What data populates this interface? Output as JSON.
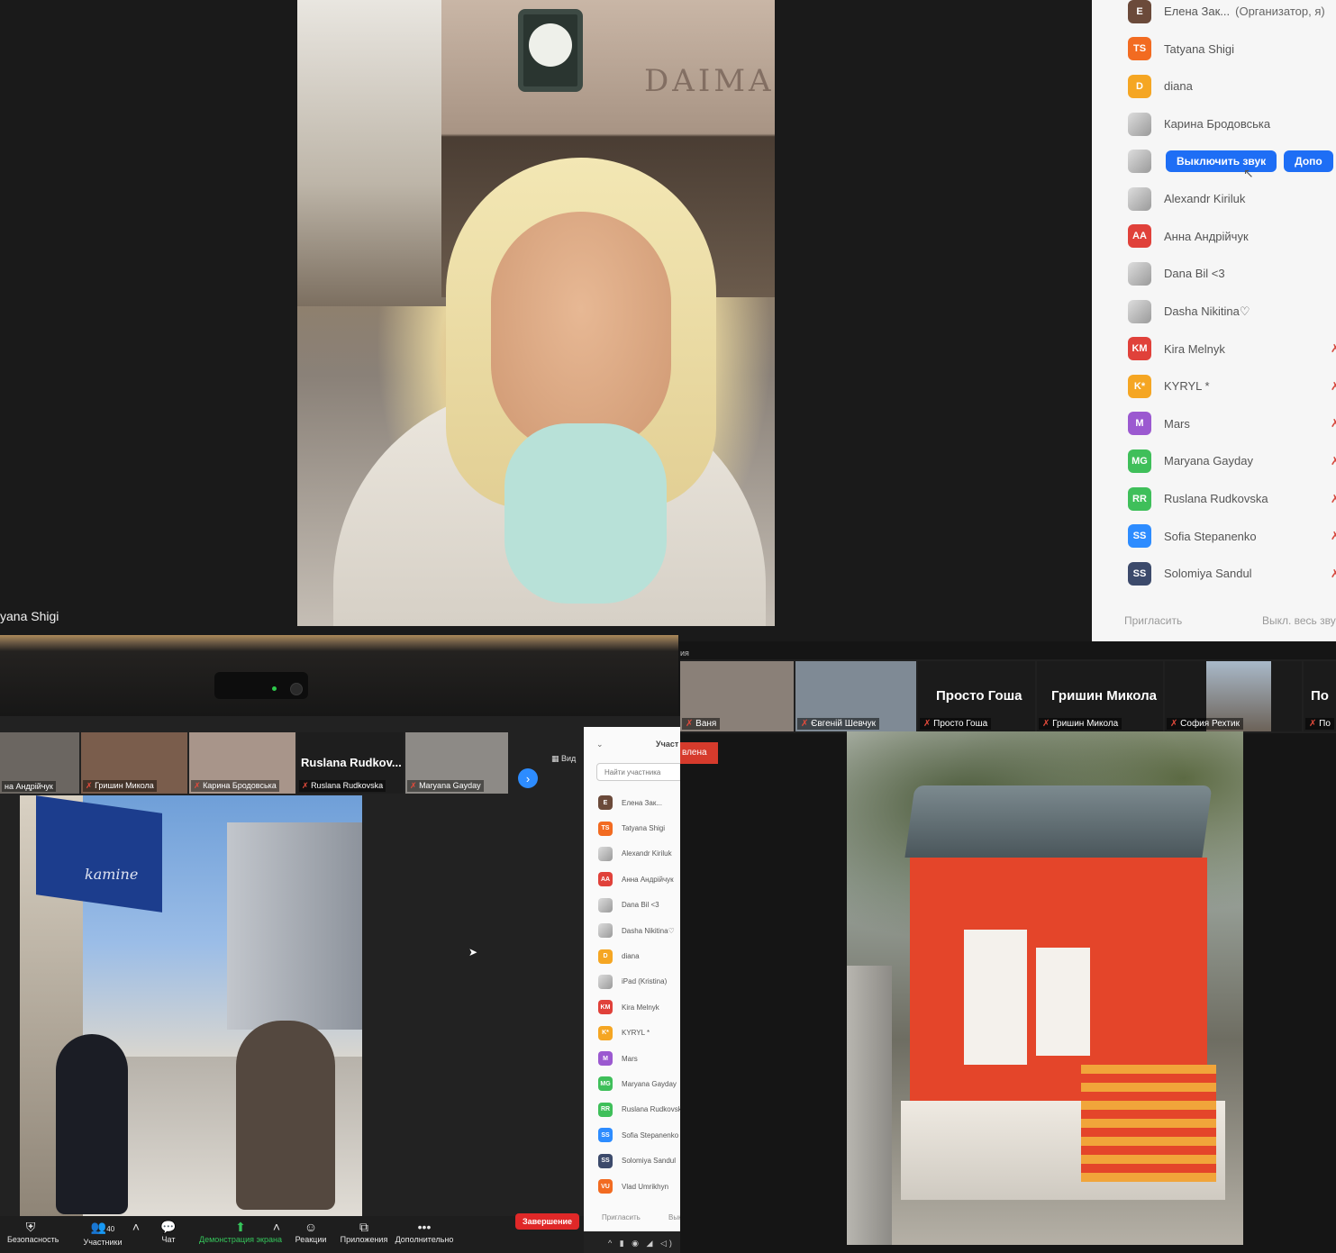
{
  "top": {
    "speaker_label": "yana Shigi",
    "video_sign": "DAIMARU",
    "participants": [
      {
        "initials": "E",
        "name": "Елена Зак...",
        "meta": "(Организатор, я)",
        "color": "#6b4a3a"
      },
      {
        "initials": "TS",
        "name": "Tatyana Shigi",
        "color": "#f26b21"
      },
      {
        "initials": "D",
        "name": "diana",
        "color": "#f5a623"
      },
      {
        "initials": "",
        "name": "Карина Бродовська",
        "img": true
      },
      {
        "initials": "",
        "name": "",
        "img": true,
        "buttons": true
      },
      {
        "initials": "",
        "name": "Alexandr Kiriluk",
        "img": true
      },
      {
        "initials": "AA",
        "name": "Анна Андрійчук",
        "color": "#e0413a"
      },
      {
        "initials": "",
        "name": "Dana Bil <3",
        "img": true
      },
      {
        "initials": "",
        "name": "Dasha Nikitina♡",
        "img": true
      },
      {
        "initials": "KM",
        "name": "Kira Melnyk",
        "color": "#e0413a"
      },
      {
        "initials": "K*",
        "name": "KYRYL *",
        "color": "#f5a623"
      },
      {
        "initials": "M",
        "name": "Mars",
        "color": "#9b59d0"
      },
      {
        "initials": "MG",
        "name": "Maryana Gayday",
        "color": "#3fbf5a"
      },
      {
        "initials": "RR",
        "name": "Ruslana Rudkovska",
        "color": "#3fbf5a"
      },
      {
        "initials": "SS",
        "name": "Sofia Stepanenko",
        "color": "#2d8cff"
      },
      {
        "initials": "SS",
        "name": "Solomiya Sandul",
        "color": "#3c4a6b"
      }
    ],
    "mute_button": "Выключить звук",
    "more_button": "Допо",
    "invite": "Пригласить",
    "mute_all": "Выкл. весь звук"
  },
  "bottom_left": {
    "thumbs": [
      {
        "label": "на Андрійчук"
      },
      {
        "label": "Гришин Микола"
      },
      {
        "label": "Карина Бродовська"
      },
      {
        "label": "Ruslana Rudkovska",
        "big": "Ruslana  Rudkov..."
      },
      {
        "label": "Maryana Gayday"
      }
    ],
    "next": "›",
    "view": "Вид",
    "panel_title": "Участ",
    "search_placeholder": "Найти участника",
    "video_sign": "kamine",
    "participants": [
      {
        "initials": "E",
        "name": "Елена Зак...",
        "color": "#6b4a3a"
      },
      {
        "initials": "TS",
        "name": "Tatyana Shigi",
        "color": "#f26b21"
      },
      {
        "initials": "",
        "name": "Alexandr Kiriluk",
        "img": true
      },
      {
        "initials": "AA",
        "name": "Анна Андрійчук",
        "color": "#e0413a"
      },
      {
        "initials": "",
        "name": "Dana Bil <3",
        "img": true
      },
      {
        "initials": "",
        "name": "Dasha Nikitina♡",
        "img": true
      },
      {
        "initials": "D",
        "name": "diana",
        "color": "#f5a623"
      },
      {
        "initials": "",
        "name": "iPad (Kristina)",
        "img": true
      },
      {
        "initials": "KM",
        "name": "Kira Melnyk",
        "color": "#e0413a"
      },
      {
        "initials": "K*",
        "name": "KYRYL *",
        "color": "#f5a623"
      },
      {
        "initials": "M",
        "name": "Mars",
        "color": "#9b59d0"
      },
      {
        "initials": "MG",
        "name": "Maryana Gayday",
        "color": "#3fbf5a"
      },
      {
        "initials": "RR",
        "name": "Ruslana Rudkovsk",
        "color": "#3fbf5a"
      },
      {
        "initials": "SS",
        "name": "Sofia Stepanenko",
        "color": "#2d8cff"
      },
      {
        "initials": "SS",
        "name": "Solomiya Sandul",
        "color": "#3c4a6b"
      },
      {
        "initials": "VU",
        "name": "Vlad Umrikhyn",
        "color": "#f26b21"
      }
    ],
    "invite": "Пригласить",
    "invite2": "Вык",
    "toolbar": {
      "security": "Безопасность",
      "participants": "Участники",
      "participants_count": "40",
      "chat": "Чат",
      "share": "Демонстрация экрана",
      "reactions": "Реакции",
      "apps": "Приложения",
      "more": "Дополнительно",
      "end": "Завершение"
    },
    "taskbar": "^ ▮ ◉ ◢ ◁)"
  },
  "bottom_right": {
    "top_strip": "ия",
    "thumbs": [
      {
        "label": "Ваня"
      },
      {
        "label": "Євгеній Шевчук"
      },
      {
        "label": "Просто Гоша",
        "big": "Просто Гоша"
      },
      {
        "label": "Гришин Микола",
        "big": "Гришин Микола"
      },
      {
        "label": "София Рехтик"
      },
      {
        "label": "По",
        "big": "По"
      }
    ],
    "rec_badge": "влена"
  }
}
